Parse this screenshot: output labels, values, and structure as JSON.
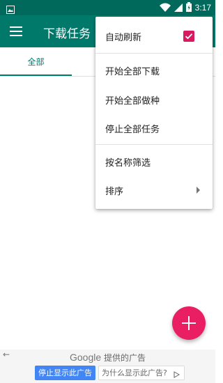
{
  "status_bar": {
    "time": "3:17"
  },
  "app_bar": {
    "title": "下载任务"
  },
  "tabs": [
    {
      "label": "全部"
    }
  ],
  "popup_menu": {
    "auto_refresh": {
      "label": "自动刷新",
      "checked": true
    },
    "items": [
      {
        "label": "开始全部下载"
      },
      {
        "label": "开始全部做种"
      },
      {
        "label": "停止全部任务"
      },
      {
        "label": "按名称筛选"
      },
      {
        "label": "排序",
        "has_submenu": true
      }
    ]
  },
  "fab": {
    "icon": "plus-icon"
  },
  "ad_banner": {
    "brand": "Google",
    "provided_text": "提供的广告",
    "stop_button": "停止显示此广告",
    "why_button": "为什么显示此广告?"
  },
  "colors": {
    "status_bar": "#00695c",
    "app_bar": "#00796b",
    "accent": "#d81b60",
    "fab": "#e91e63"
  }
}
